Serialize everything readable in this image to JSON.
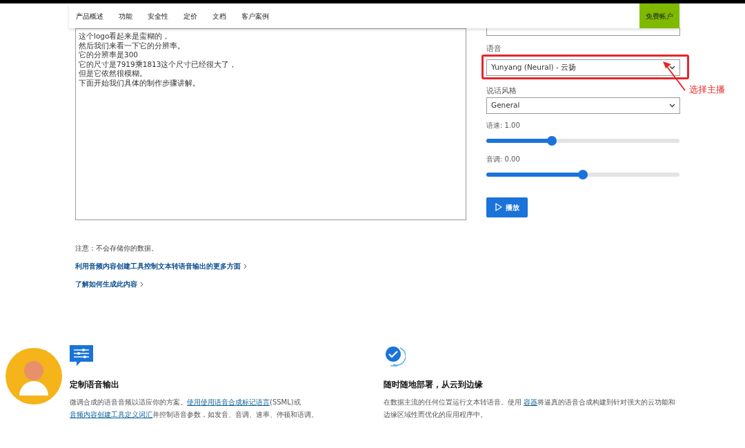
{
  "nav": {
    "items": [
      {
        "label": "产品概述"
      },
      {
        "label": "功能"
      },
      {
        "label": "安全性"
      },
      {
        "label": "定价"
      },
      {
        "label": "文档"
      },
      {
        "label": "客户案例"
      }
    ],
    "cta": "免费帐户"
  },
  "editor": {
    "lines": [
      "这个logo看起来是蛮糊的，",
      "然后我们来看一下它的分辨率。",
      "它的分辨率是300",
      "它的尺寸是7919乘1813这个尺寸已经很大了，",
      "但是它依然很模糊。",
      "下面开始我们具体的制作步骤讲解。"
    ]
  },
  "voice": {
    "label": "语音",
    "value": "Yunyang (Neural) - 云扬",
    "annotation": "选择主播"
  },
  "style": {
    "label": "说话风格",
    "value": "General"
  },
  "rate": {
    "label": "语速: 1.00",
    "level": 0.34
  },
  "pitch": {
    "label": "音调: 0.00",
    "level": 0.5
  },
  "play_button": "播放",
  "note": "注意：不会存储你的数据。",
  "links": [
    "利用音频内容创建工具控制文本转语音输出的更多方面",
    "了解如何生成此内容"
  ],
  "features": [
    {
      "kind": "sliders",
      "title": "定制语音输出",
      "body": [
        {
          "text": "微调合成的语音音频以适应你的方案。",
          "link": false
        },
        {
          "text": "使用使用语音合成标记语言",
          "link": true
        },
        {
          "text": "(SSML)或",
          "link": false
        },
        {
          "text": "音频内容创建工具定义词汇",
          "link": true
        },
        {
          "text": "并控制语音参数，如发音、音调、速率、停顿和语调。",
          "link": false
        }
      ]
    },
    {
      "kind": "globe",
      "title": "随时随地部署，从云到边缘",
      "body": [
        {
          "text": "在数据主流的任何位置运行文本转语音。使用 ",
          "link": false
        },
        {
          "text": "容器",
          "link": true
        },
        {
          "text": "将逼真的语音合成构建到针对强大的云功能和边缘区域性而优化的应用程序中。",
          "link": false
        }
      ]
    }
  ]
}
